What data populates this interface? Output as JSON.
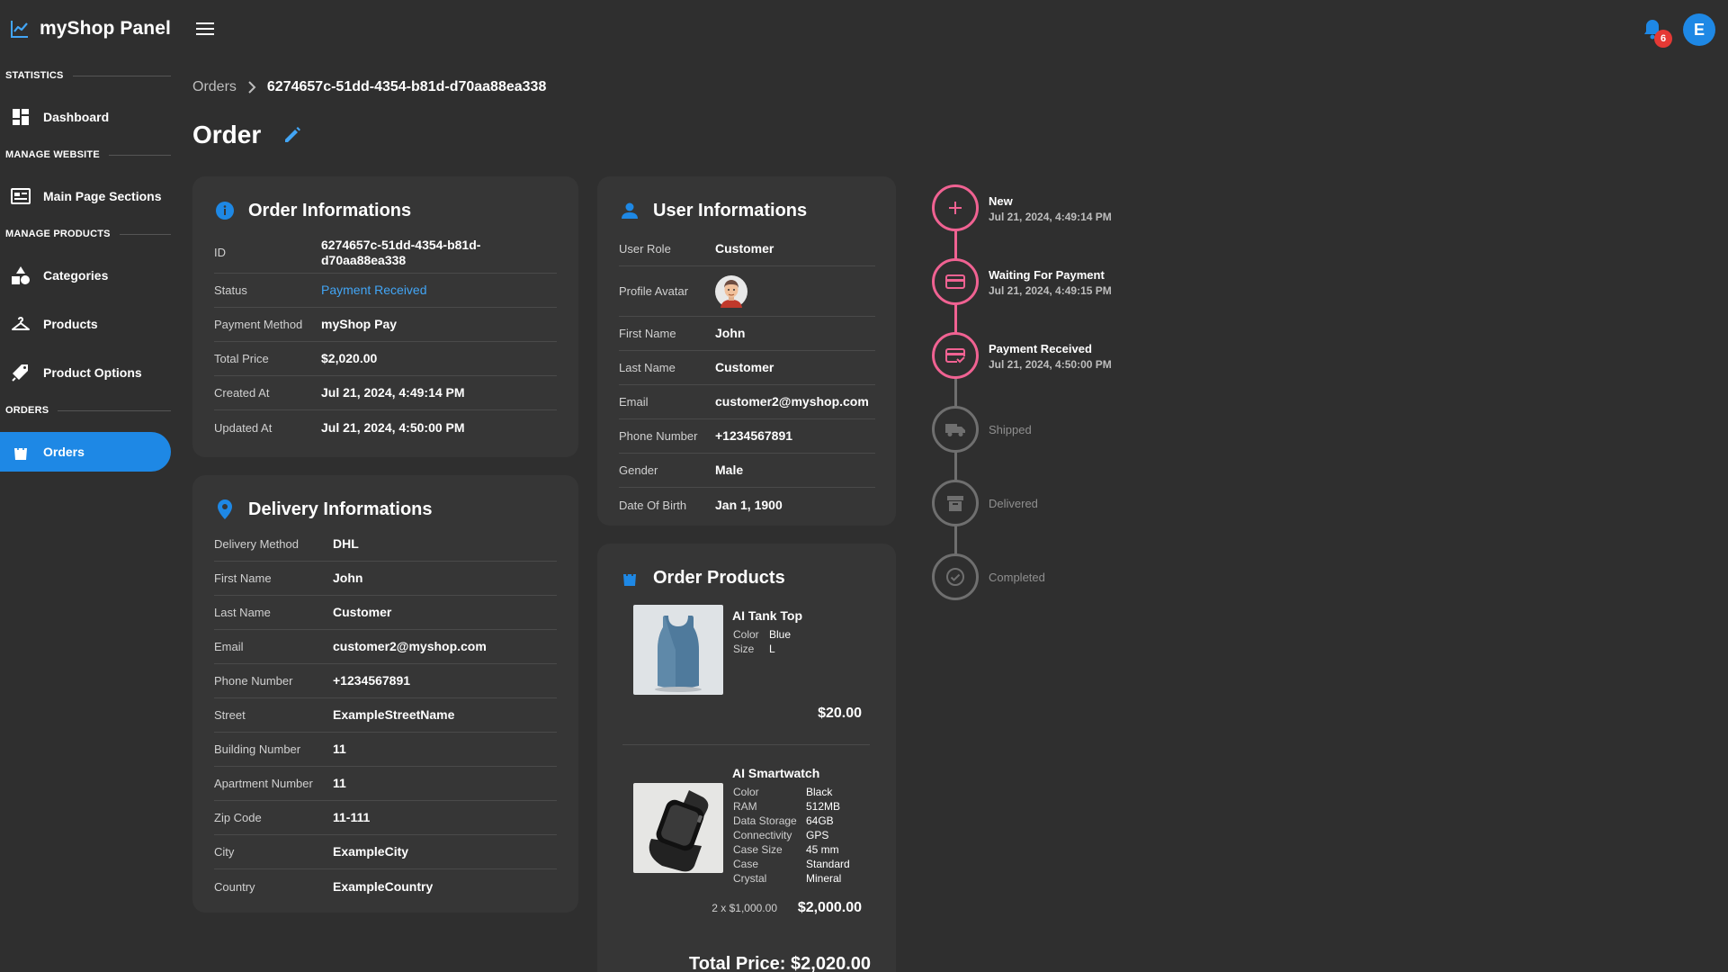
{
  "app": {
    "title": "myShop Panel"
  },
  "sidebar": {
    "sections": [
      {
        "label": "STATISTICS"
      },
      {
        "label": "MANAGE WEBSITE"
      },
      {
        "label": "MANAGE PRODUCTS"
      },
      {
        "label": "ORDERS"
      }
    ],
    "items": [
      {
        "label": "Dashboard",
        "icon": "dashboard-icon"
      },
      {
        "label": "Main Page Sections",
        "icon": "web-sections-icon"
      },
      {
        "label": "Categories",
        "icon": "categories-icon"
      },
      {
        "label": "Products",
        "icon": "hanger-icon"
      },
      {
        "label": "Product Options",
        "icon": "tags-icon"
      },
      {
        "label": "Orders",
        "icon": "shopping-bag-icon",
        "active": true
      }
    ]
  },
  "topbar": {
    "notifications_count": "6",
    "user_initial": "E"
  },
  "breadcrumb": {
    "parent": "Orders",
    "current": "6274657c-51dd-4354-b81d-d70aa88ea338"
  },
  "page": {
    "title": "Order"
  },
  "order_info": {
    "title": "Order Informations",
    "rows": [
      {
        "label": "ID",
        "value": "6274657c-51dd-4354-b81d-d70aa88ea338"
      },
      {
        "label": "Status",
        "value": "Payment Received"
      },
      {
        "label": "Payment Method",
        "value": "myShop Pay"
      },
      {
        "label": "Total Price",
        "value": "$2,020.00"
      },
      {
        "label": "Created At",
        "value": "Jul 21, 2024, 4:49:14 PM"
      },
      {
        "label": "Updated At",
        "value": "Jul 21, 2024, 4:50:00 PM"
      }
    ]
  },
  "delivery_info": {
    "title": "Delivery Informations",
    "rows": [
      {
        "label": "Delivery Method",
        "value": "DHL"
      },
      {
        "label": "First Name",
        "value": "John"
      },
      {
        "label": "Last Name",
        "value": "Customer"
      },
      {
        "label": "Email",
        "value": "customer2@myshop.com"
      },
      {
        "label": "Phone Number",
        "value": "+1234567891"
      },
      {
        "label": "Street",
        "value": "ExampleStreetName"
      },
      {
        "label": "Building Number",
        "value": "11"
      },
      {
        "label": "Apartment Number",
        "value": "11"
      },
      {
        "label": "Zip Code",
        "value": "11-111"
      },
      {
        "label": "City",
        "value": "ExampleCity"
      },
      {
        "label": "Country",
        "value": "ExampleCountry"
      }
    ]
  },
  "user_info": {
    "title": "User Informations",
    "rows": [
      {
        "label": "User Role",
        "value": "Customer"
      },
      {
        "label": "Profile Avatar",
        "value": ""
      },
      {
        "label": "First Name",
        "value": "John"
      },
      {
        "label": "Last Name",
        "value": "Customer"
      },
      {
        "label": "Email",
        "value": "customer2@myshop.com"
      },
      {
        "label": "Phone Number",
        "value": "+1234567891"
      },
      {
        "label": "Gender",
        "value": "Male"
      },
      {
        "label": "Date Of Birth",
        "value": "Jan 1, 1900"
      }
    ]
  },
  "order_products": {
    "title": "Order Products",
    "products": [
      {
        "name": "AI Tank Top",
        "options": [
          {
            "k": "Color",
            "v": "Blue"
          },
          {
            "k": "Size",
            "v": "L"
          }
        ],
        "price": "$20.00"
      },
      {
        "name": "AI Smartwatch",
        "options": [
          {
            "k": "Color",
            "v": "Black"
          },
          {
            "k": "RAM",
            "v": "512MB"
          },
          {
            "k": "Data Storage",
            "v": "64GB"
          },
          {
            "k": "Connectivity",
            "v": "GPS"
          },
          {
            "k": "Case Size",
            "v": "45 mm"
          },
          {
            "k": "Case",
            "v": "Standard"
          },
          {
            "k": "Crystal",
            "v": "Mineral"
          }
        ],
        "qty_text": "2 x $1,000.00",
        "price": "$2,000.00"
      }
    ],
    "total": "Total Price: $2,020.00"
  },
  "timeline": {
    "accent_color": "#f06292",
    "steps": [
      {
        "title": "New",
        "date": "Jul 21, 2024, 4:49:14 PM",
        "done": true,
        "icon": "plus-icon"
      },
      {
        "title": "Waiting For Payment",
        "date": "Jul 21, 2024, 4:49:15 PM",
        "done": true,
        "icon": "credit-card-icon"
      },
      {
        "title": "Payment Received",
        "date": "Jul 21, 2024, 4:50:00 PM",
        "done": true,
        "icon": "card-check-icon"
      },
      {
        "title": "Shipped",
        "date": "",
        "done": false,
        "icon": "truck-icon"
      },
      {
        "title": "Delivered",
        "date": "",
        "done": false,
        "icon": "archive-box-icon"
      },
      {
        "title": "Completed",
        "date": "",
        "done": false,
        "icon": "check-circle-icon"
      }
    ]
  }
}
